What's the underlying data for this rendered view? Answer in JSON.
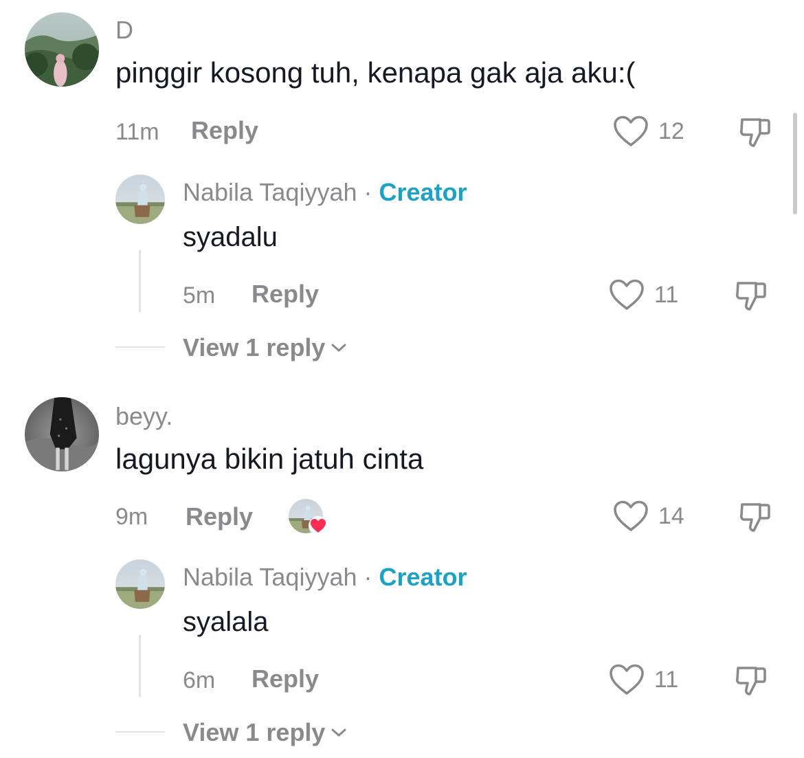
{
  "comments": [
    {
      "username": "D",
      "text": "pinggir kosong tuh, kenapa gak aja aku:(",
      "time": "11m",
      "reply_label": "Reply",
      "likes": "12",
      "reply": {
        "username": "Nabila Taqiyyah",
        "separator": "·",
        "badge": "Creator",
        "text": "syadalu",
        "time": "5m",
        "reply_label": "Reply",
        "likes": "11"
      },
      "view_replies_label": "View 1 reply"
    },
    {
      "username": "beyy.",
      "text": "lagunya bikin jatuh cinta",
      "time": "9m",
      "reply_label": "Reply",
      "likes": "14",
      "reply": {
        "username": "Nabila Taqiyyah",
        "separator": "·",
        "badge": "Creator",
        "text": "syalala",
        "time": "6m",
        "reply_label": "Reply",
        "likes": "11"
      },
      "view_replies_label": "View 1 reply"
    }
  ],
  "colors": {
    "secondary_text": "#8a8a8e",
    "primary_text": "#161823",
    "creator_badge": "#1aa3c7",
    "creator_liked_heart": "#fe2c55"
  }
}
